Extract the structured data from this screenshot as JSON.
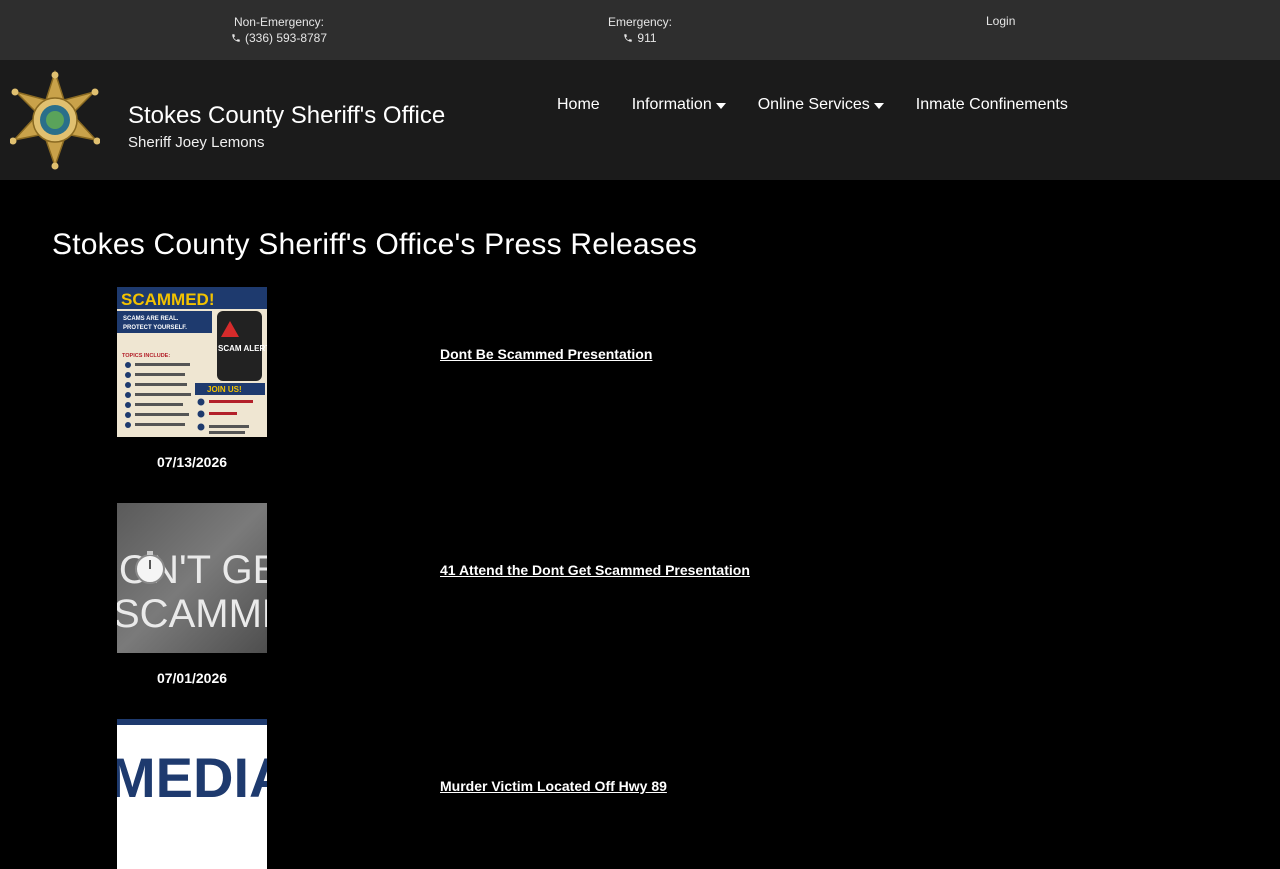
{
  "topbar": {
    "non_emergency_label": "Non-Emergency:",
    "non_emergency_phone": "(336) 593-8787",
    "emergency_label": "Emergency:",
    "emergency_phone": "911",
    "login_label": "Login"
  },
  "header": {
    "title": "Stokes County Sheriff's Office",
    "subtitle": "Sheriff Joey Lemons",
    "nav": [
      {
        "label": "Home"
      },
      {
        "label": "Information",
        "has_dropdown": true
      },
      {
        "label": "Online Services",
        "has_dropdown": true
      },
      {
        "label": "Inmate Confinements"
      }
    ]
  },
  "main": {
    "page_title": "Stokes County Sheriff's Office's Press Releases",
    "releases": [
      {
        "title": "Dont Be Scammed Presentation",
        "date": "07/13/2026",
        "thumb_text": [
          "SCAMMED!",
          "SCAMS ARE REAL.",
          "PROTECT YOURSELF.",
          "TOPICS INCLUDE:",
          "SCAM ALERT",
          "JOIN US!"
        ]
      },
      {
        "title": "41 Attend the Dont Get Scammed Presentation",
        "date": "07/01/2026",
        "thumb_text": [
          "ON'T GE",
          "SCAMME"
        ]
      },
      {
        "title": "Murder Victim Located Off Hwy 89",
        "date": "",
        "thumb_text": [
          "MEDIA"
        ]
      }
    ]
  },
  "colors": {
    "topbar_bg": "#2e2e2e",
    "header_bg": "#1b1b1b",
    "page_bg": "#000000",
    "badge_gold": "#c9a24a"
  }
}
